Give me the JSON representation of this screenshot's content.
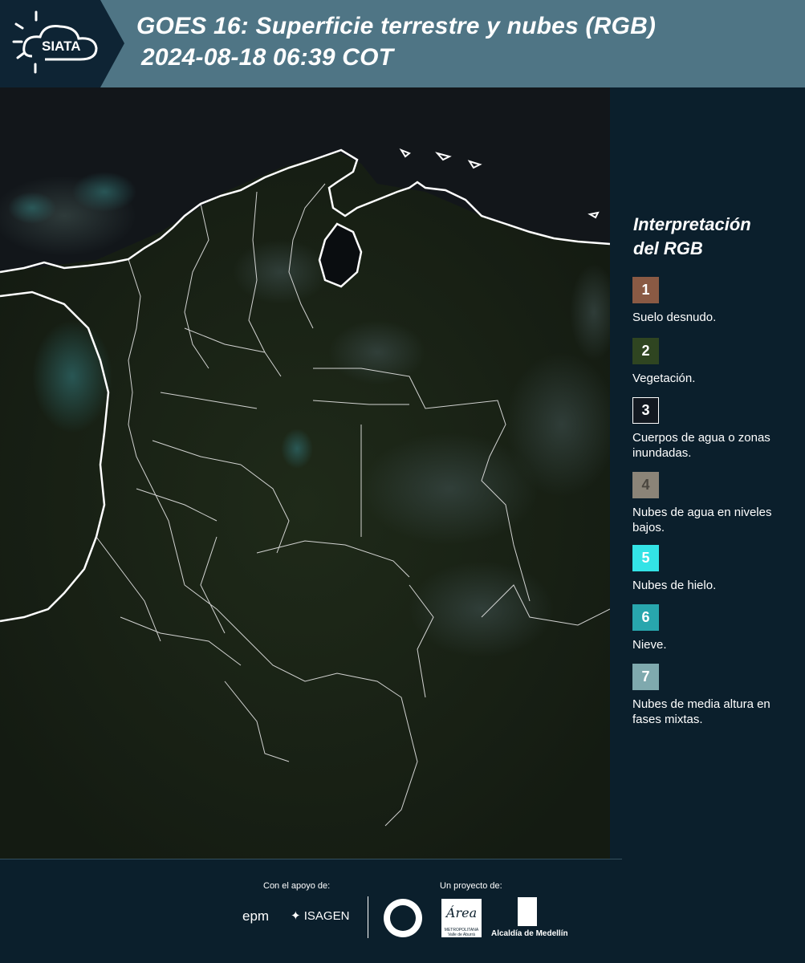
{
  "header": {
    "logo_text": "SIATA",
    "title_line1": "GOES 16: Superficie terrestre y nubes (RGB)",
    "title_line2": "2024-08-18 06:39 COT"
  },
  "legend": {
    "title_line1": "Interpretación",
    "title_line2": "del RGB",
    "items": [
      {
        "number": "1",
        "label": "Suelo desnudo.",
        "color": "#8a5a44"
      },
      {
        "number": "2",
        "label": "Vegetación.",
        "color": "#2f4521"
      },
      {
        "number": "3",
        "label": "Cuerpos de agua o zonas inundadas.",
        "color": "#121820"
      },
      {
        "number": "4",
        "label": "Nubes de agua en niveles bajos.",
        "color": "#8b8478"
      },
      {
        "number": "5",
        "label": "Nubes de hielo.",
        "color": "#33e3e6"
      },
      {
        "number": "6",
        "label": "Nieve.",
        "color": "#28a6ad"
      },
      {
        "number": "7",
        "label": "Nubes de media altura en fases mixtas.",
        "color": "#7fa9ae"
      }
    ]
  },
  "footer": {
    "support_caption": "Con el apoyo de:",
    "project_caption": "Un proyecto de:",
    "sponsor_epm": "epm",
    "sponsor_isagen": "ISAGEN",
    "area_logo_text": "Área",
    "area_logo_sub": "METROPOLITANA Valle de Aburrá",
    "alcaldia_text": "Alcaldía de Medellín"
  },
  "colors": {
    "header_bg": "#4f7585",
    "page_bg": "#0b1f2c",
    "map_bg": "#141a12"
  }
}
